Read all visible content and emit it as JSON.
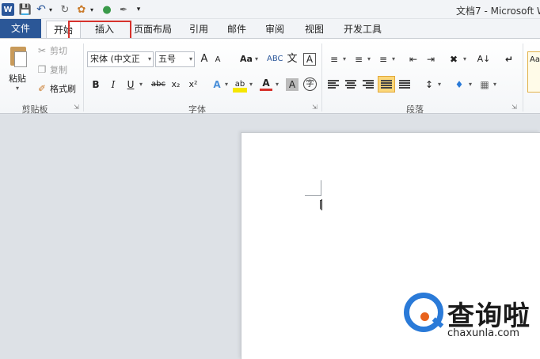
{
  "window": {
    "title": "文档7 - Microsoft W"
  },
  "quick_access": {
    "app_icon": "W",
    "save_icon": "save-icon",
    "undo_icon": "undo-icon",
    "redo_icon": "redo-icon",
    "paint_icon": "format-painter-icon",
    "color_icon": "color-icon",
    "pen_icon": "pen-icon",
    "customize_icon": "customize-icon"
  },
  "tabs": [
    {
      "label": "文件"
    },
    {
      "label": "开始"
    },
    {
      "label": "插入"
    },
    {
      "label": "页面布局"
    },
    {
      "label": "引用"
    },
    {
      "label": "邮件"
    },
    {
      "label": "审阅"
    },
    {
      "label": "视图"
    },
    {
      "label": "开发工具"
    }
  ],
  "clipboard": {
    "group_label": "剪贴板",
    "paste": "粘贴",
    "cut": "剪切",
    "copy": "复制",
    "format_painter": "格式刷"
  },
  "font": {
    "group_label": "字体",
    "font_name": "宋体 (中文正",
    "font_size": "五号",
    "grow": "A",
    "shrink": "A",
    "case": "Aa",
    "pinyin": "文",
    "border_char": "A",
    "bold": "B",
    "italic": "I",
    "underline": "U",
    "strike": "abc",
    "subscript": "x₂",
    "superscript": "x²",
    "effect": "A",
    "highlight": "ab",
    "color": "A",
    "shade": "A",
    "enclose": "字"
  },
  "paragraph": {
    "group_label": "段落"
  },
  "colors": {
    "file_tab": "#2b5797",
    "highlight_box": "#d6322c",
    "watermark_blue": "#2a7ad8",
    "watermark_orange": "#e8621c"
  },
  "watermark": {
    "text": "查询啦",
    "url": "chaxunla.com"
  }
}
